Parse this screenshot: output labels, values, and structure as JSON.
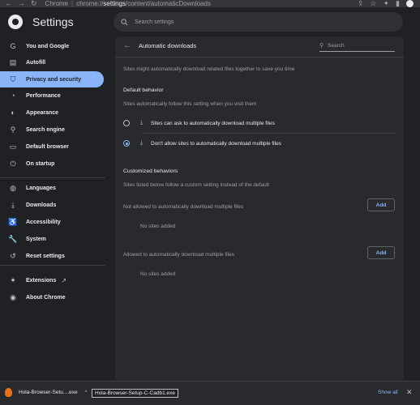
{
  "browser": {
    "nav_back": "←",
    "nav_forward": "→",
    "nav_reload": "↻",
    "host": "Chrome",
    "separator": "|",
    "url_prefix": "chrome://",
    "url_bold": "settings",
    "url_suffix": "/content/automaticDownloads",
    "icons": [
      "share-icon",
      "star-icon",
      "extensions-icon",
      "side-panel-icon",
      "profile-icon"
    ]
  },
  "header": {
    "title": "Settings",
    "search_placeholder": "Search settings"
  },
  "sidebar": {
    "items": [
      {
        "label": "You and Google",
        "icon": "google-icon",
        "glyph": "G",
        "selected": false
      },
      {
        "label": "Autofill",
        "icon": "clipboard-icon",
        "glyph": "▤",
        "selected": false
      },
      {
        "label": "Privacy and security",
        "icon": "shield-icon",
        "glyph": "⛉",
        "selected": true
      },
      {
        "label": "Performance",
        "icon": "speedometer-icon",
        "glyph": "◔",
        "selected": false
      },
      {
        "label": "Appearance",
        "icon": "palette-icon",
        "glyph": "◐",
        "selected": false
      },
      {
        "label": "Search engine",
        "icon": "search-icon",
        "glyph": "⚲",
        "selected": false
      },
      {
        "label": "Default browser",
        "icon": "browser-icon",
        "glyph": "▭",
        "selected": false
      },
      {
        "label": "On startup",
        "icon": "power-icon",
        "glyph": "⏻",
        "selected": false
      },
      {
        "label": "Languages",
        "icon": "globe-icon",
        "glyph": "◍",
        "selected": false
      },
      {
        "label": "Downloads",
        "icon": "download-icon",
        "glyph": "⤓",
        "selected": false
      },
      {
        "label": "Accessibility",
        "icon": "accessibility-icon",
        "glyph": "♿",
        "selected": false
      },
      {
        "label": "System",
        "icon": "wrench-icon",
        "glyph": "🔧",
        "selected": false
      },
      {
        "label": "Reset settings",
        "icon": "reset-icon",
        "glyph": "↺",
        "selected": false
      },
      {
        "label": "Extensions",
        "icon": "puzzle-icon",
        "glyph": "✦",
        "selected": false,
        "external_icon": "open-in-new-icon",
        "external_glyph": "↗"
      },
      {
        "label": "About Chrome",
        "icon": "chrome-icon",
        "glyph": "◉",
        "selected": false
      }
    ],
    "accent_color": "#8ab4f8"
  },
  "page": {
    "title": "Automatic downloads",
    "search_placeholder": "Search",
    "description": "Sites might automatically download related files together to save you time",
    "default_behavior": {
      "heading": "Default behavior",
      "subheading": "Sites automatically follow this setting when you visit them",
      "options": [
        {
          "label": "Sites can ask to automatically download multiple files",
          "icon": "download-icon",
          "glyph": "⤓",
          "selected": false
        },
        {
          "label": "Don't allow sites to automatically download multiple files",
          "icon": "download-blocked-icon",
          "glyph": "⤓",
          "selected": true
        }
      ]
    },
    "customized": {
      "heading": "Customized behaviors",
      "subheading": "Sites listed below follow a custom setting instead of the default",
      "not_allowed": {
        "label": "Not allowed to automatically download multiple files",
        "button": "Add",
        "empty": "No sites added"
      },
      "allowed": {
        "label": "Allowed to automatically download multiple files",
        "button": "Add",
        "empty": "No sites added"
      }
    }
  },
  "download_bar": {
    "item_name": "Hola-Browser-Setu....exe",
    "tooltip": "Hola-Browser-Setup-C-Cadb1.exe",
    "caret": "^",
    "show_all": "Show all",
    "close": "✕"
  }
}
